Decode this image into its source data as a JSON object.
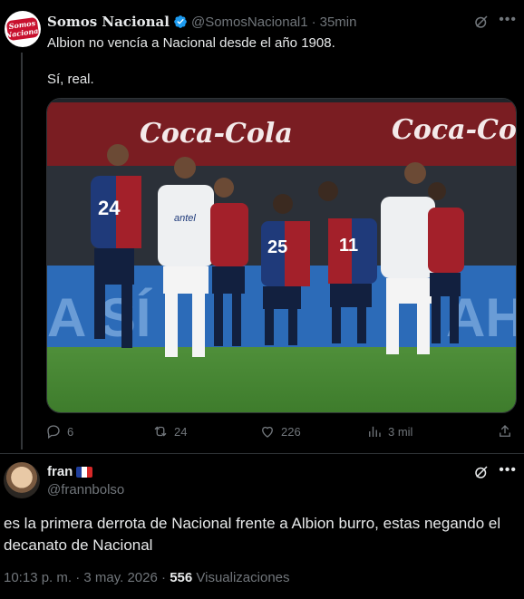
{
  "quoted_tweet": {
    "avatar_text_line1": "Somos",
    "avatar_text_line2": "Nacional",
    "display_name": "Somos Nacional",
    "handle": "@SomosNacional1",
    "separator": "·",
    "time_ago": "35min",
    "text_lines": [
      "Albion no vencía a Nacional desde el año 1908.",
      "Sí, real."
    ],
    "media": {
      "description": "photo",
      "banner_text_left": "Coca-Cola",
      "banner_text_right": "Coca-Cola",
      "player_numbers": [
        "24",
        "25",
        "11"
      ],
      "sponsor_text": "antel"
    },
    "actions": {
      "replies": "6",
      "reposts": "24",
      "likes": "226",
      "views": "3 mil"
    }
  },
  "reply_tweet": {
    "display_name": "fran",
    "flag": "france-flag",
    "handle": "@frannbolso",
    "text": "es la primera derrota de Nacional frente a Albion burro, estas negando el decanato de Nacional",
    "time": "10:13 p. m.",
    "separator": "·",
    "date": "3 may. 2026",
    "views_count": "556",
    "views_label": "Visualizaciones"
  },
  "colors": {
    "background": "#000000",
    "text_primary": "#e7e9ea",
    "text_secondary": "#71767b",
    "verified": "#1d9bf0",
    "divider": "#2f3336"
  }
}
